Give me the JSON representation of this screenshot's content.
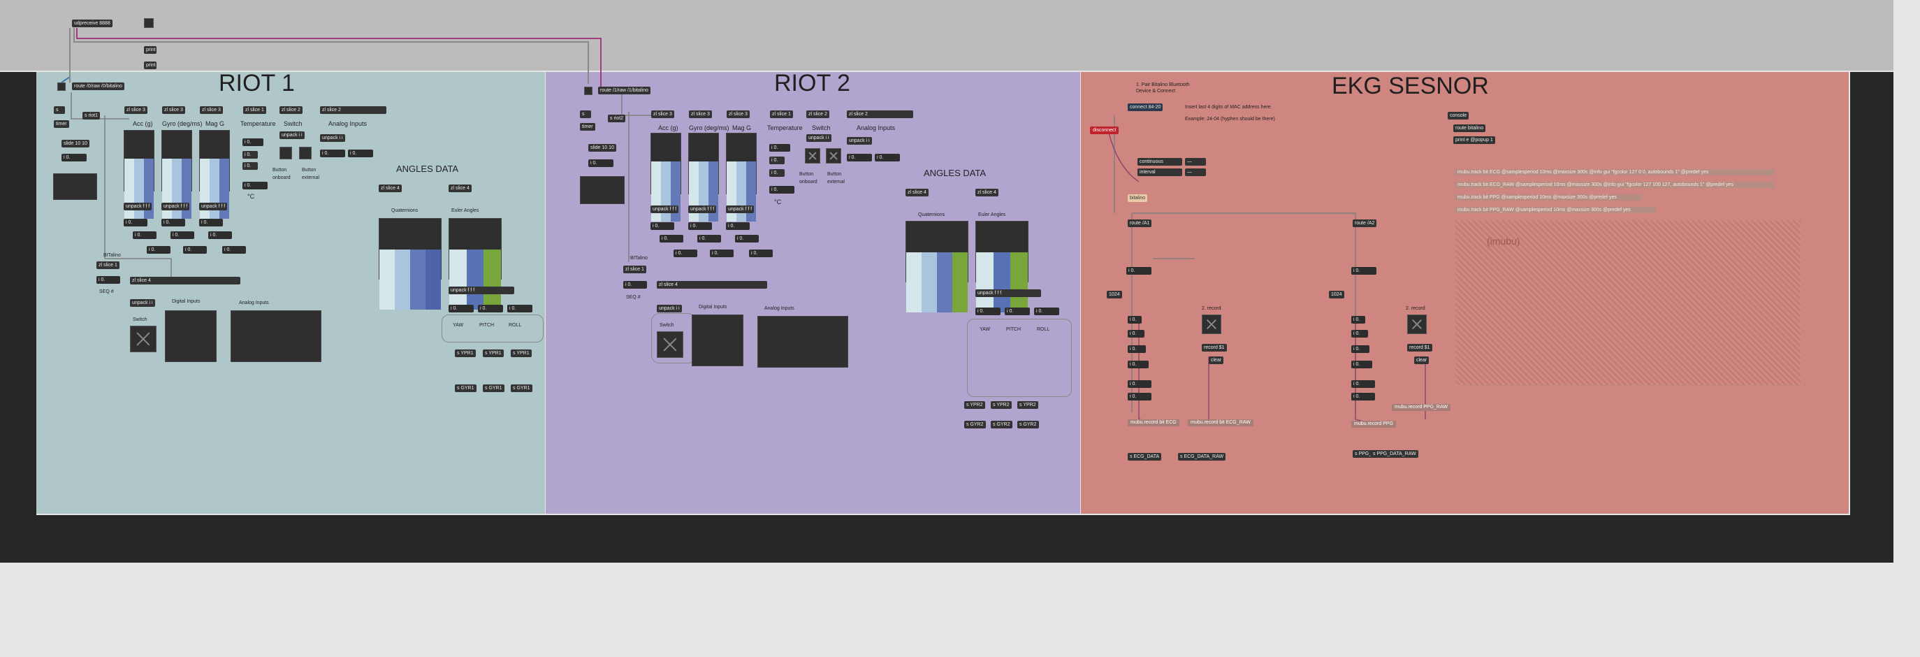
{
  "topbar": {
    "udp_object": "udpreceive 8888",
    "misc": [
      "print",
      "print"
    ]
  },
  "riot1": {
    "title": "RIOT 1",
    "route": "route /0/raw /0/bitalino",
    "small_objs": [
      "s",
      "s riot1",
      "timer",
      "slide 10 10",
      "i 0."
    ],
    "slice_boxes": [
      "zl slice 3",
      "zl slice 3",
      "zl slice 3",
      "zl slice 1",
      "zl slice 2",
      "zl slice 2"
    ],
    "labels": {
      "acc": "Acc (g)",
      "gyro": "Gyro (deg/ms)",
      "mag": "Mag G",
      "temperature": "Temperature",
      "switch": "Switch",
      "analog_inputs": "Analog Inputs",
      "button_onboard": "Button onboard",
      "button_external": "Button external",
      "celsius": "°C",
      "angles_data": "ANGLES DATA",
      "quaternions": "Quaternions",
      "euler_angles": "Euler Angles",
      "bitalino": "BITalino",
      "seq": "SEQ #",
      "digital_inputs": "Digital Inputs",
      "analog_inputs2": "Analog Inputs",
      "switch2": "Switch",
      "yaw": "YAW",
      "pitch": "PITCH",
      "roll": "ROLL"
    },
    "unpack": "unpack f f f",
    "unpack_i": "unpack i i",
    "slice4": "zl slice 4",
    "slice1": "zl slice 1",
    "num": "i 0.",
    "sends_ypr": [
      "s YPR1",
      "s YPR1",
      "s YPR1"
    ],
    "sends_gyr": [
      "s GYR1",
      "s GYR1",
      "s GYR1"
    ]
  },
  "riot2": {
    "title": "RIOT 2",
    "route": "route /1/raw /1/bitalino",
    "small_objs": [
      "s",
      "s riot2",
      "timer",
      "slide 10 10",
      "i 0."
    ],
    "labels": {
      "acc": "Acc (g)",
      "gyro": "Gyro (deg/ms)",
      "mag": "Mag G",
      "temperature": "Temperature",
      "switch": "Switch",
      "analog_inputs": "Analog Inputs",
      "button_onboard": "Button onboard",
      "button_external": "Button external",
      "celsius": "°C",
      "angles_data": "ANGLES DATA",
      "quaternions": "Quaternions",
      "euler_angles": "Euler Angles",
      "bitalino": "BITalino",
      "seq": "SEQ #",
      "digital_inputs": "Digital Inputs",
      "analog_inputs2": "Analog Inputs",
      "switch2": "Switch",
      "yaw": "YAW",
      "pitch": "PITCH",
      "roll": "ROLL"
    },
    "sends_ypr": [
      "s YPR2",
      "s YPR2",
      "s YPR2"
    ],
    "sends_gyr": [
      "s GYR2",
      "s GYR2",
      "s GYR2"
    ]
  },
  "ekg": {
    "title": "EKG SESNOR",
    "instructions": [
      "1. Pair Bitalino Bluetooth",
      "Device & Connect"
    ],
    "connect": "connect 84-20",
    "disconnect": "disconnect",
    "mac_hint": "Insert last 4 digits of MAC address here.",
    "mac_example": "Example: 24-04 (hyphen should be there)",
    "continuous": "continuous",
    "interval": "interval",
    "bitalino": "bitalino",
    "route_a1": "route /A1",
    "route_a2": "route /A2",
    "num": "i 0.",
    "n1024": "1024",
    "record2": "2. record",
    "record_msg": "record $1",
    "clear": "clear",
    "mubu_ecg": "mubu.record bit ECG",
    "mubu_ecg_raw": "mubu.record bit ECG_RAW",
    "mubu_ppg": "mubu.record PPG",
    "mubu_ppg_raw": "mubu.record PPG_RAW",
    "s_ecg": "s ECG_DATA",
    "s_ecg_raw": "s ECG_DATA_RAW",
    "s_ppg": "s PPG_DATA",
    "s_ppg_raw": "s PPG_DATA_RAW",
    "console": "console",
    "route_bitalino": "route bitalino",
    "print_bitalino": "print e @popup 1",
    "tracks": [
      "mubu.track bit ECG @samplesperiod 10ms @maxsize 300s @info gui \"fgcolor 127 0 0, autobounds 1\" @predef yes",
      "mubu.track bit ECG_RAW @samplesperiod 10ms @maxsize 300s @info gui \"fgcolor 127 100 127, autobounds 1\" @predef yes",
      "mubu.track bit PPG @samplesperiod 10ms @maxsize 300s @predef yes",
      "mubu.track bit PPG_RAW @samplesperiod 10ms @maxsize 300s @predef yes"
    ],
    "imubu": "(imubu)"
  }
}
